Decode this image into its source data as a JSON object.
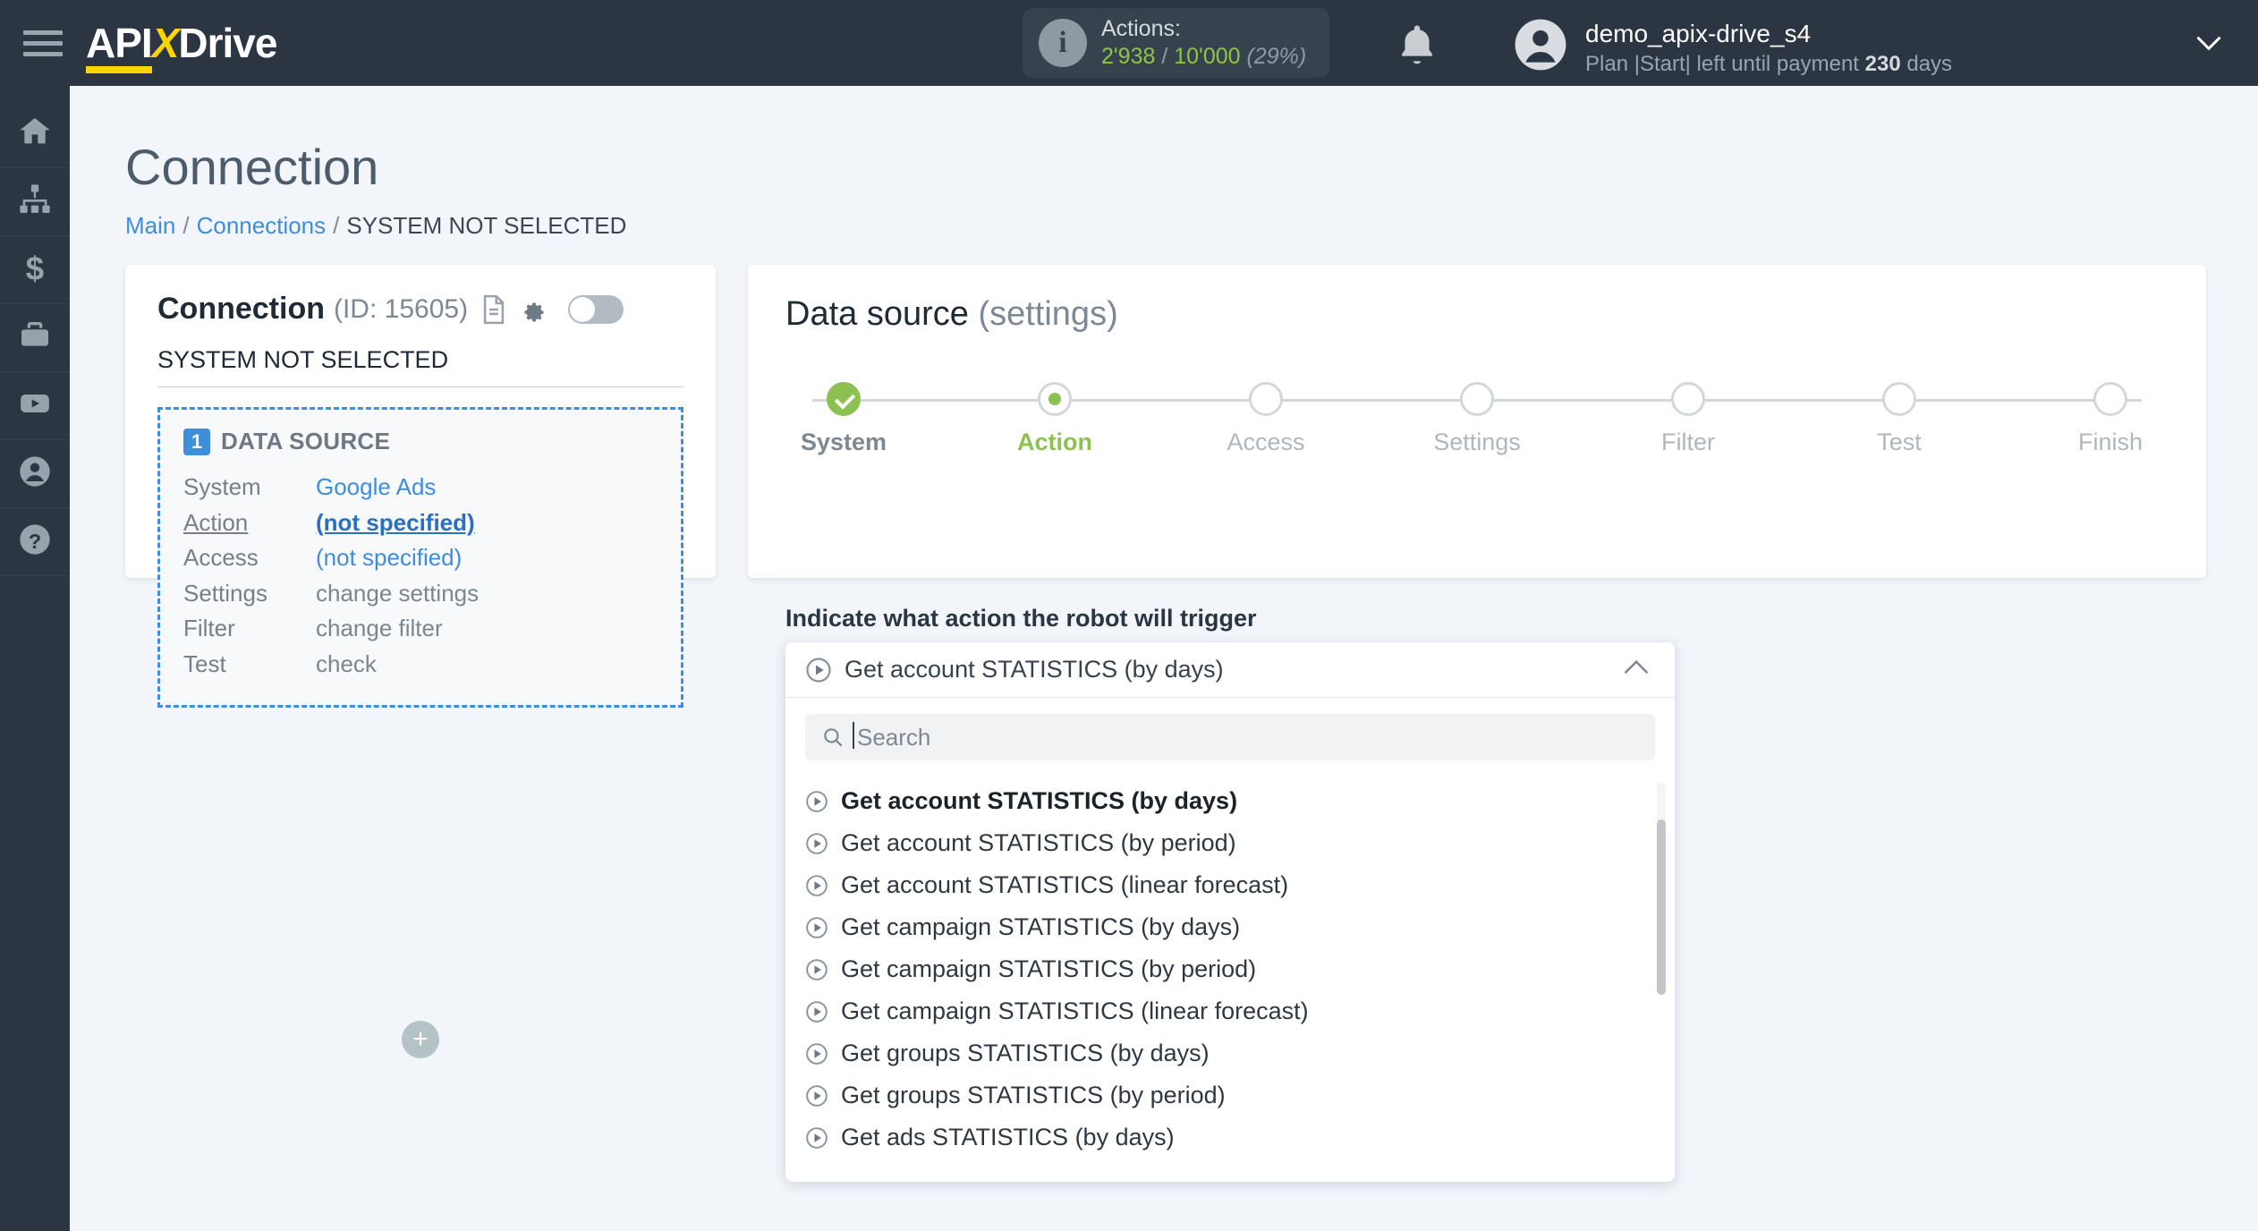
{
  "topbar": {
    "logo_api": "API",
    "logo_x": "X",
    "logo_drive": "Drive",
    "actions_label": "Actions:",
    "actions_used": "2'938",
    "actions_separator": "/",
    "actions_total": "10'000",
    "actions_percent": "(29%)",
    "account_name": "demo_apix-drive_s4",
    "account_plan": "Plan |Start| left until payment ",
    "account_days": "230",
    "account_days_suffix": " days"
  },
  "sidebar": {
    "items": [
      {
        "name": "home",
        "icon": "home-icon"
      },
      {
        "name": "connections",
        "icon": "sitemap-icon"
      },
      {
        "name": "billing",
        "icon": "dollar-icon"
      },
      {
        "name": "services",
        "icon": "briefcase-icon"
      },
      {
        "name": "videos",
        "icon": "youtube-icon"
      },
      {
        "name": "profile",
        "icon": "user-icon"
      },
      {
        "name": "help",
        "icon": "question-icon"
      }
    ]
  },
  "page": {
    "title": "Connection",
    "breadcrumb": {
      "main": "Main",
      "connections": "Connections",
      "current": "SYSTEM NOT SELECTED",
      "separator": "/"
    }
  },
  "connection_card": {
    "title": "Connection",
    "id_label": "(ID: 15605)",
    "subtitle": "SYSTEM NOT SELECTED",
    "block_number": "1",
    "block_title": "DATA SOURCE",
    "rows": [
      {
        "key": "System",
        "value": "Google Ads",
        "style": "blue"
      },
      {
        "key": "Action",
        "value": "(not specified)",
        "style": "blue-bold"
      },
      {
        "key": "Access",
        "value": "(not specified)",
        "style": "blue"
      },
      {
        "key": "Settings",
        "value": "change settings",
        "style": "muted"
      },
      {
        "key": "Filter",
        "value": "change filter",
        "style": "muted"
      },
      {
        "key": "Test",
        "value": "check",
        "style": "muted"
      }
    ],
    "add_button": "+"
  },
  "data_source_panel": {
    "title": "Data source",
    "title_muted": "(settings)",
    "steps": [
      {
        "label": "System",
        "state": "done"
      },
      {
        "label": "Action",
        "state": "active"
      },
      {
        "label": "Access",
        "state": "todo"
      },
      {
        "label": "Settings",
        "state": "todo"
      },
      {
        "label": "Filter",
        "state": "todo"
      },
      {
        "label": "Test",
        "state": "todo"
      },
      {
        "label": "Finish",
        "state": "todo"
      }
    ],
    "field_label": "Indicate what action the robot will trigger",
    "select": {
      "selected_value": "Get account STATISTICS (by days)",
      "search_placeholder": "Search",
      "search_value": "",
      "options": [
        "Get account STATISTICS (by days)",
        "Get account STATISTICS (by period)",
        "Get account STATISTICS (linear forecast)",
        "Get campaign STATISTICS (by days)",
        "Get campaign STATISTICS (by period)",
        "Get campaign STATISTICS (linear forecast)",
        "Get groups STATISTICS (by days)",
        "Get groups STATISTICS (by period)",
        "Get ads STATISTICS (by days)"
      ],
      "selected_index": 0
    }
  },
  "colors": {
    "brand_dark": "#2b3642",
    "brand_yellow": "#ffd400",
    "accent_blue": "#3f8ddb",
    "success_green": "#8cc152",
    "page_bg": "#f2f5fa"
  }
}
